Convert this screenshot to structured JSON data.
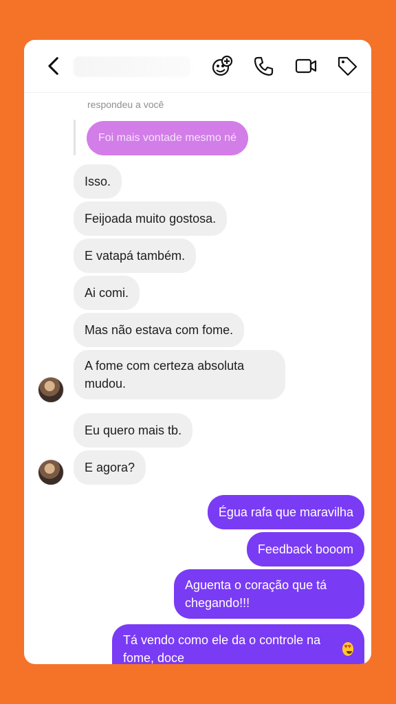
{
  "colors": {
    "background": "#F47328",
    "incoming_bubble": "#EFEFEF",
    "outgoing_bubble": "#7A3BF4",
    "reply_bubble": "#D27DE8"
  },
  "header": {
    "back_icon": "chevron-left-icon",
    "contact_name": "",
    "actions": [
      "sticker-add-icon",
      "phone-icon",
      "video-camera-icon",
      "tag-icon"
    ]
  },
  "reply": {
    "label": "respondeu a você",
    "quoted_text": "Foi mais vontade mesmo né"
  },
  "messages": [
    {
      "sender": "them",
      "text": "Isso."
    },
    {
      "sender": "them",
      "text": "Feijoada muito gostosa."
    },
    {
      "sender": "them",
      "text": "E vatapá também."
    },
    {
      "sender": "them",
      "text": "Ai comi."
    },
    {
      "sender": "them",
      "text": "Mas não estava com fome."
    },
    {
      "sender": "them",
      "text": "A fome com certeza absoluta mudou."
    },
    {
      "sender": "them",
      "text": "Eu quero mais tb."
    },
    {
      "sender": "them",
      "text": "E agora?"
    },
    {
      "sender": "me",
      "text": "Égua rafa que maravilha"
    },
    {
      "sender": "me",
      "text": "Feedback booom"
    },
    {
      "sender": "me",
      "text": "Aguenta o coração que tá chegando!!!"
    },
    {
      "sender": "me",
      "text": "Tá vendo como ele da o controle na fome, doce",
      "emoji": "heart-eyes-emoji"
    }
  ]
}
